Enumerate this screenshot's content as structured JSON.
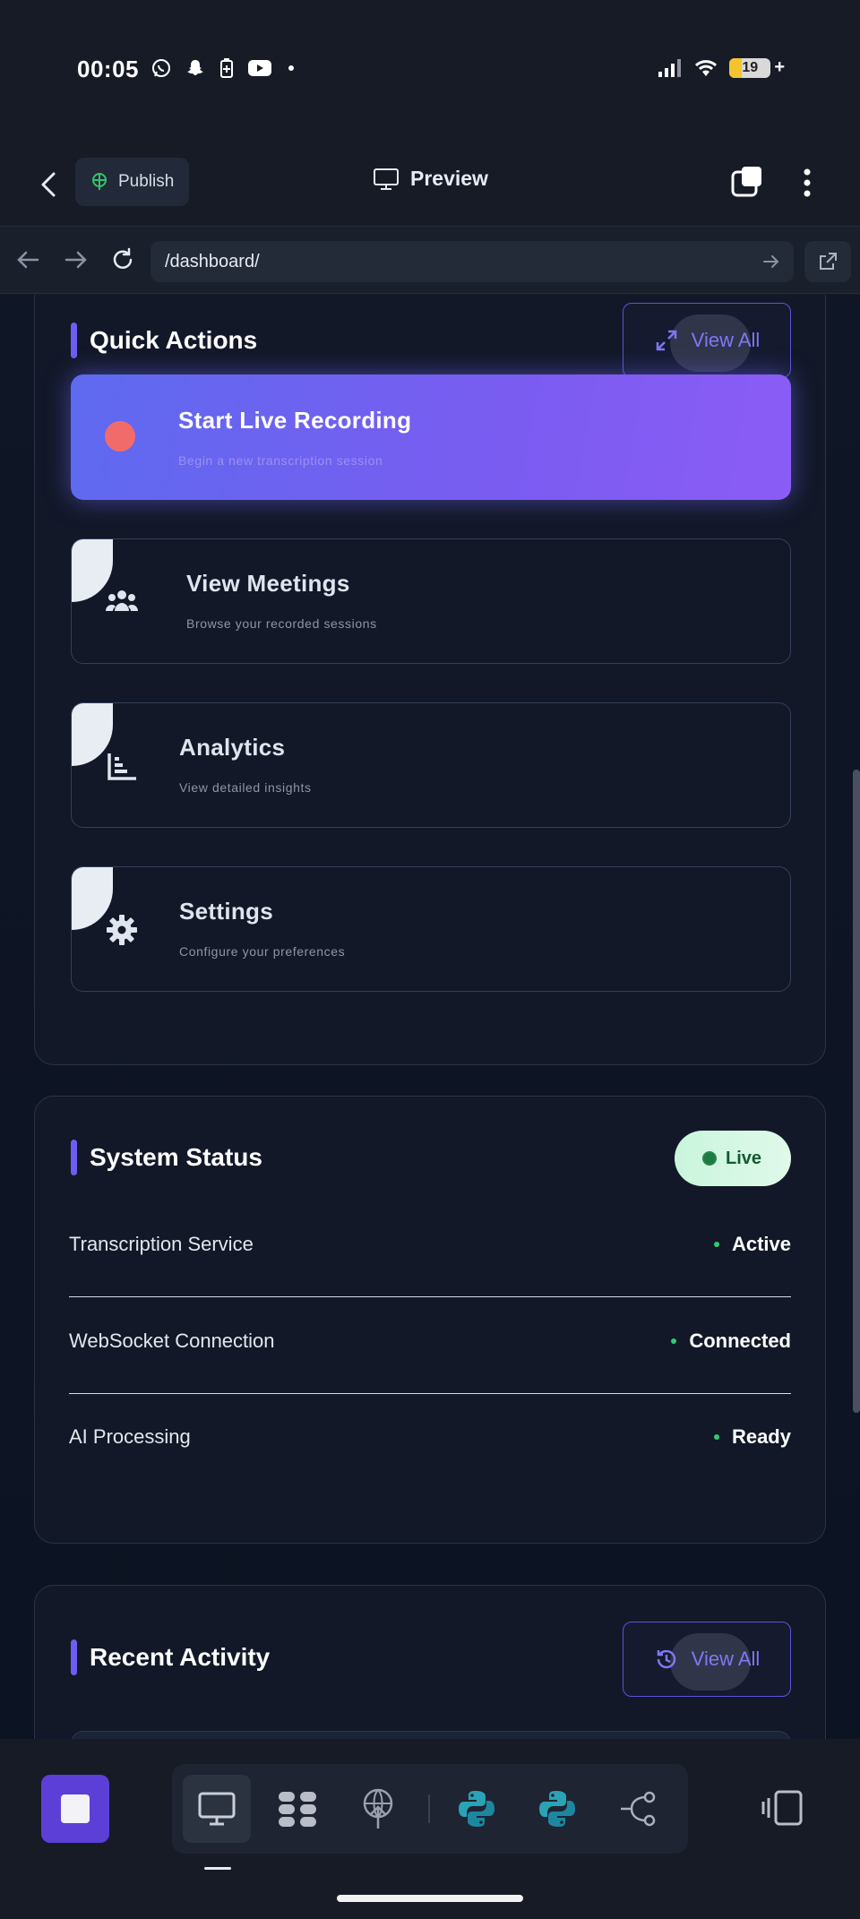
{
  "status_bar": {
    "time": "00:05",
    "battery": "19"
  },
  "app_bar": {
    "publish_label": "Publish",
    "preview_label": "Preview"
  },
  "browser": {
    "url": "/dashboard/"
  },
  "quick_actions": {
    "title": "Quick Actions",
    "view_all_label": "View All",
    "items": [
      {
        "title": "Start Live Recording",
        "subtitle": "Begin a new transcription session"
      },
      {
        "title": "View Meetings",
        "subtitle": "Browse your recorded sessions"
      },
      {
        "title": "Analytics",
        "subtitle": "View detailed insights"
      },
      {
        "title": "Settings",
        "subtitle": "Configure your preferences"
      }
    ]
  },
  "system_status": {
    "title": "System Status",
    "badge": "Live",
    "rows": [
      {
        "label": "Transcription Service",
        "value": "Active"
      },
      {
        "label": "WebSocket Connection",
        "value": "Connected"
      },
      {
        "label": "AI Processing",
        "value": "Ready"
      }
    ],
    "status_color": "#2ecc71"
  },
  "recent_activity": {
    "title": "Recent Activity",
    "view_all_label": "View All"
  },
  "colors": {
    "accent": "#6d5df2",
    "background": "#161b26",
    "recording_dot": "#f26b6b"
  }
}
